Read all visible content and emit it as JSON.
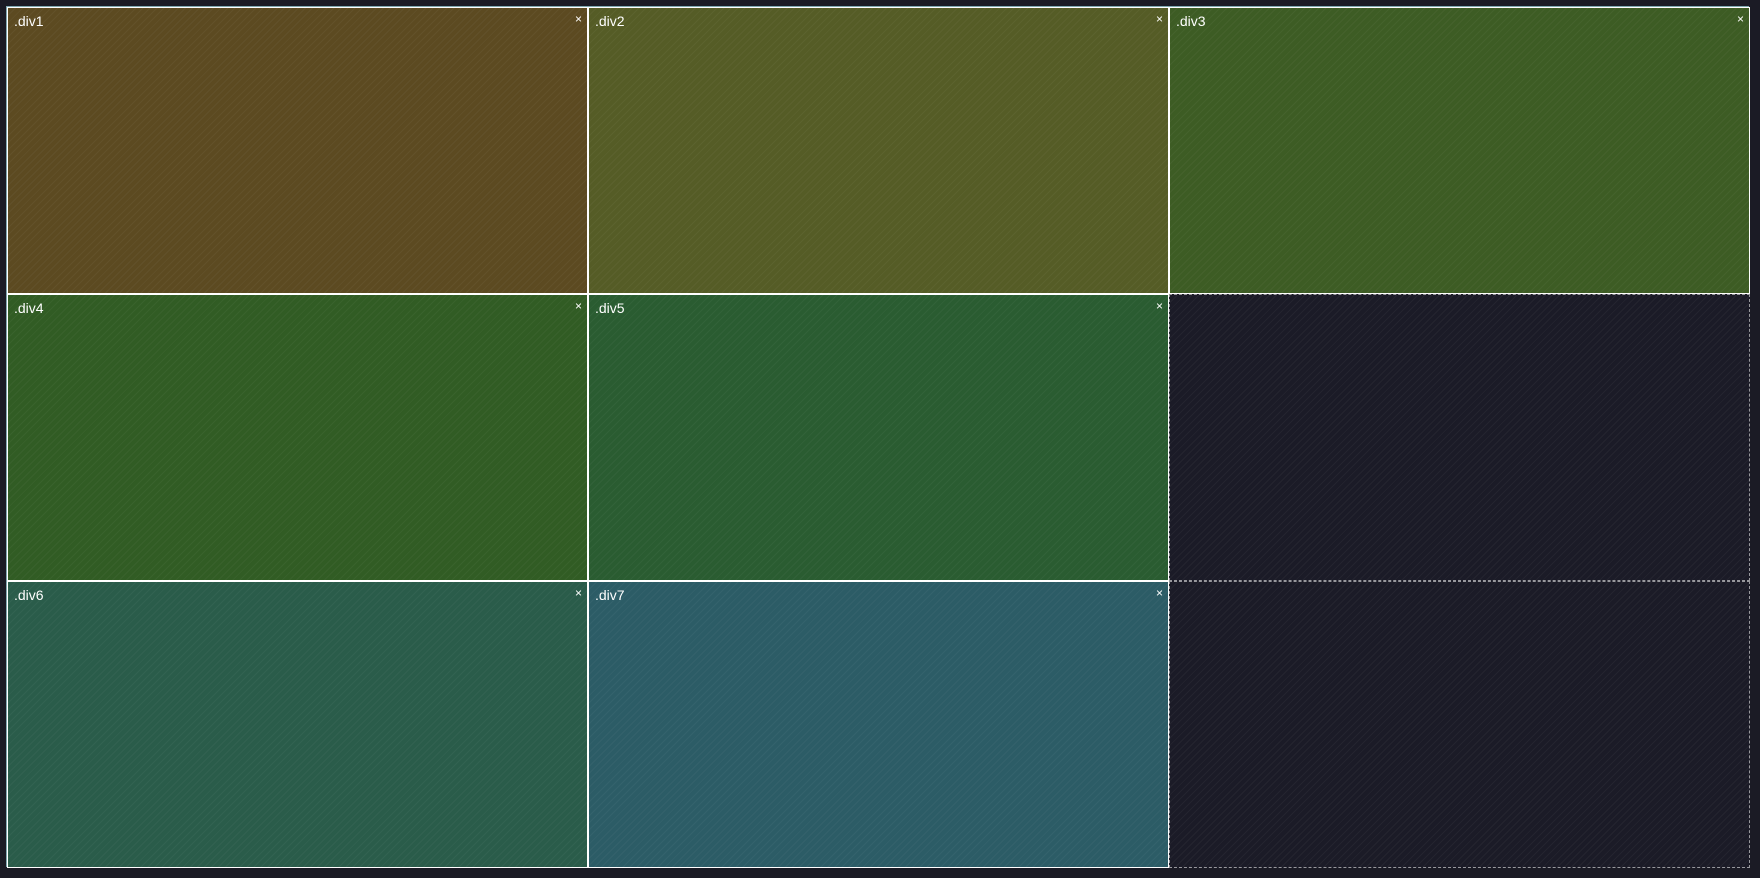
{
  "grid": {
    "items": [
      {
        "label": ".div1",
        "close": "×",
        "color": "#5c4a21"
      },
      {
        "label": ".div2",
        "close": "×",
        "color": "#555c26"
      },
      {
        "label": ".div3",
        "close": "×",
        "color": "#3d5c24"
      },
      {
        "label": ".div4",
        "close": "×",
        "color": "#315c24"
      },
      {
        "label": ".div5",
        "close": "×",
        "color": "#2a5c31"
      },
      {
        "label": ".div6",
        "close": "×",
        "color": "#2a5c4a"
      },
      {
        "label": ".div7",
        "close": "×",
        "color": "#2c5c66"
      }
    ],
    "empty_cell_color": "#1b1b27",
    "border_color": "#ffffff",
    "container_border_color": "#7fa8b0"
  }
}
